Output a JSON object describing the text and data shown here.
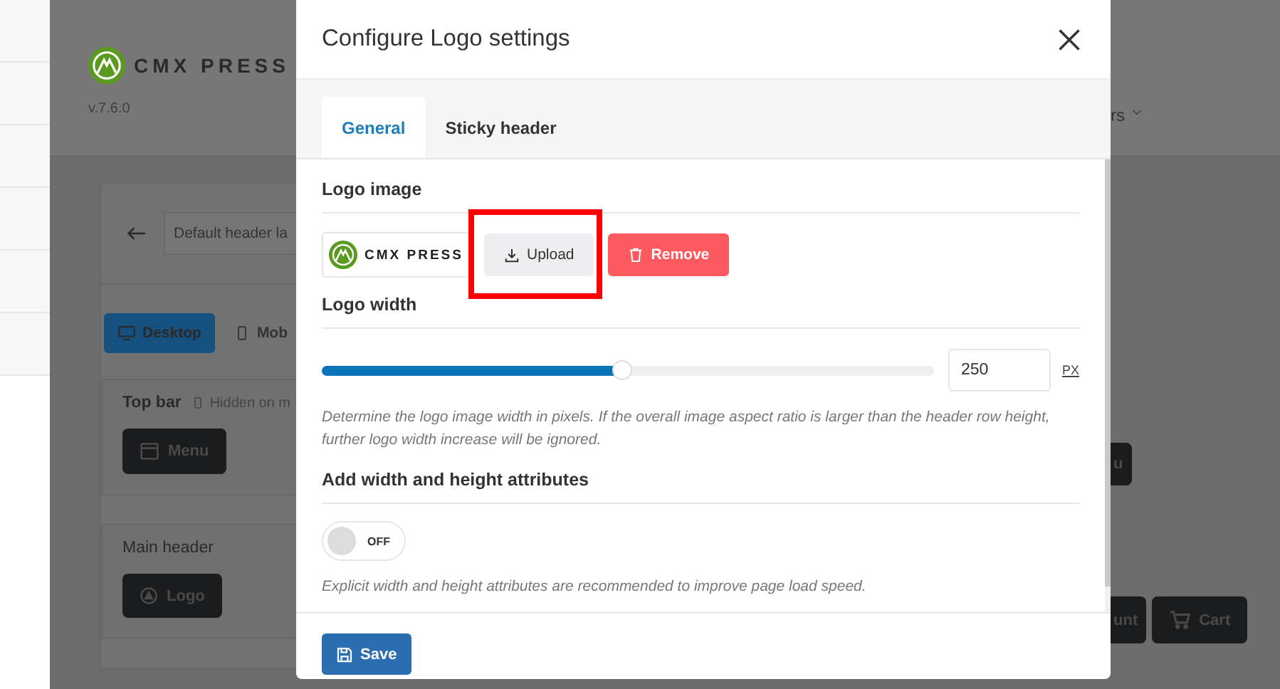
{
  "page": {
    "brand": "CMX PRESS",
    "version": "v.7.6.0",
    "layout_field": "Default header la",
    "device_tabs": [
      {
        "label": "Desktop",
        "selected": true
      },
      {
        "label": "Mob",
        "selected": false
      }
    ],
    "top_bar": {
      "title": "Top bar",
      "note": "Hidden on m",
      "element": "Menu"
    },
    "main_header": {
      "title": "Main header",
      "element": "Logo"
    },
    "right": {
      "menu": "rs",
      "top_element": "u",
      "elements": [
        {
          "label": "unt",
          "kind": "text"
        },
        {
          "label": "Cart",
          "kind": "cart"
        }
      ]
    }
  },
  "modal": {
    "title": "Configure Logo settings",
    "tabs": [
      {
        "label": "General",
        "selected": true
      },
      {
        "label": "Sticky header",
        "selected": false
      }
    ],
    "logo_image": {
      "label": "Logo image",
      "preview": "CMX PRESS",
      "upload": "Upload",
      "remove": "Remove"
    },
    "logo_width": {
      "label": "Logo width",
      "level": 0.49,
      "value": "250",
      "unit": "PX",
      "help": "Determine the logo image width in pixels. If the overall image aspect ratio is larger than the header row height, further logo width increase will be ignored."
    },
    "attributes": {
      "label": "Add width and height attributes",
      "on": false,
      "toggle_text": "OFF",
      "help": "Explicit width and height attributes are recommended to improve page load speed."
    },
    "save": "Save"
  }
}
